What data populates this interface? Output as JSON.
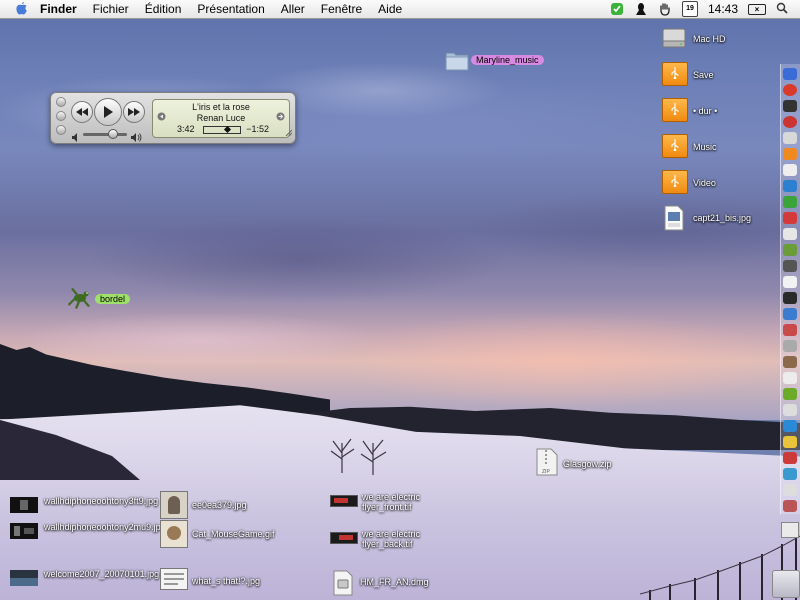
{
  "menubar": {
    "app_name": "Finder",
    "items": [
      "Fichier",
      "Édition",
      "Présentation",
      "Aller",
      "Fenêtre",
      "Aide"
    ],
    "calendar_day": "19",
    "time": "14:43",
    "battery_glyph": "×"
  },
  "player": {
    "track": "L'iris et la rose",
    "artist": "Renan Luce",
    "elapsed": "3:42",
    "remaining": "−1:52",
    "volume_fraction": 0.65,
    "progress_fraction": 0.66
  },
  "desktop": {
    "right_column": [
      {
        "label": "Mac HD",
        "kind": "hd"
      },
      {
        "label": "Save",
        "kind": "usb"
      },
      {
        "label": "• dur •",
        "kind": "usb"
      },
      {
        "label": "Music",
        "kind": "usb"
      },
      {
        "label": "Video",
        "kind": "usb"
      },
      {
        "label": "capt21_bis.jpg",
        "kind": "jpeg"
      }
    ],
    "folder_label": "Maryline_music",
    "gecko_label": "bordel",
    "zip_label": "Glasgow.zip",
    "files": {
      "f1": "wallhdiphoneoohtony3ft9.jpg",
      "f2": "wallhdiphoneoohtony2mu9.jpg",
      "f3": "welcome2007_20070101.jpg",
      "f4": "ee0ea379.jpg",
      "f5": "Cat_MouseGame.gif",
      "f6": "what_s that!?.jpg",
      "f7": "we are electric flyer_front.tif",
      "f8": "we are electric flyer_back.tif",
      "f9": "HM_FR_AN.dmg"
    }
  },
  "colors": {
    "folder_label_bg": "#d68be0",
    "gecko_label_bg": "#9fe06a",
    "usb_orange": "#f59a20"
  }
}
